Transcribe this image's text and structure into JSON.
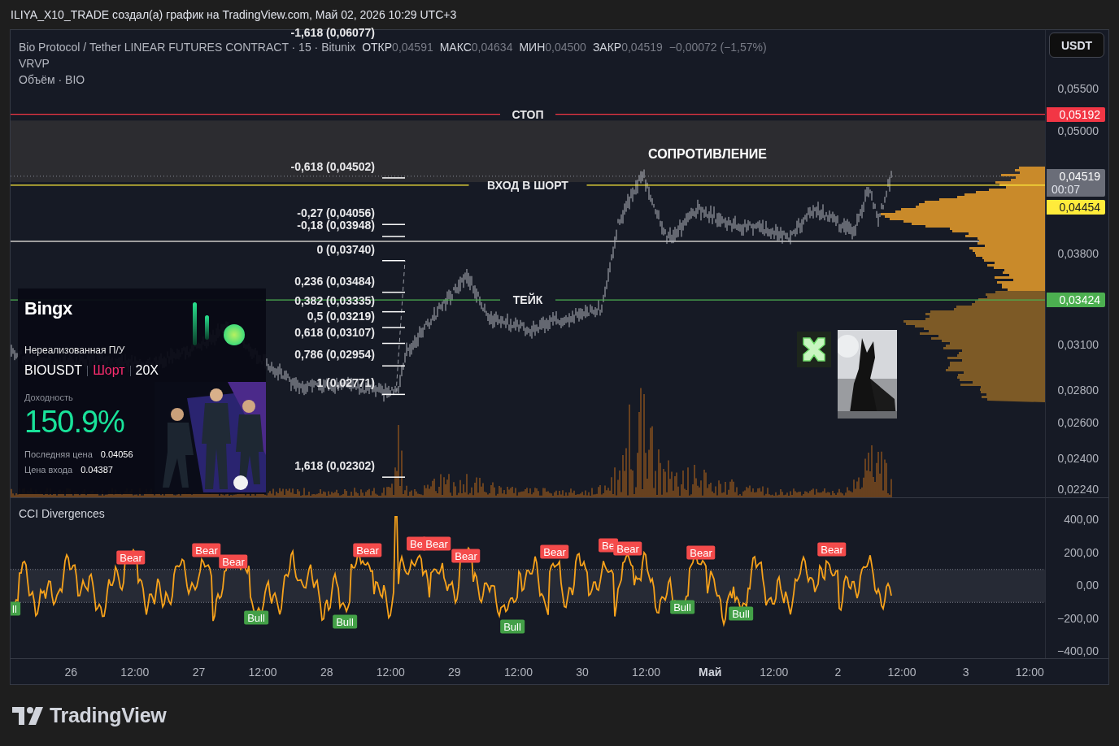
{
  "caption": "ILIYA_X10_TRADE создал(а) график на TradingView.com, Май 02, 2026 10:29 UTC+3",
  "legend": {
    "title": "Bio Protocol / Tether LINEAR FUTURES CONTRACT · 15 · Bitunix",
    "ohlc": [
      {
        "label": "ОТКР",
        "value": "0,04591"
      },
      {
        "label": "МАКС",
        "value": "0,04634"
      },
      {
        "label": "МИН",
        "value": "0,04500"
      },
      {
        "label": "ЗАКР",
        "value": "0,04519"
      }
    ],
    "change": "−0,00072 (−1,57%)"
  },
  "indicators": [
    "VRVP",
    "Объём · BIO"
  ],
  "currency_button": "USDT",
  "price_axis_ticks": [
    "0,05500",
    "0,05000",
    "0,03800",
    "0,03100",
    "0,02800",
    "0,02600",
    "0,02400",
    "0,02240"
  ],
  "last_price": {
    "value": "0,04519",
    "countdown": "00:07"
  },
  "lines": [
    {
      "label": "СТОП",
      "value": "0,05192",
      "color": "#f23645"
    },
    {
      "label": "ВХОД В ШОРТ",
      "value": "0,04454",
      "color": "#ffeb3b"
    },
    {
      "label": "ТЕЙК",
      "value": "0,03424",
      "color": "#4caf50"
    }
  ],
  "zone": {
    "label": "СОПРОТИВЛЕНИЕ"
  },
  "fib_levels": [
    "-1,618 (0,06077)",
    "-0,618 (0,04502)",
    "-0,27 (0,04056)",
    "-0,18 (0,03948)",
    "0 (0,03740)",
    "0,236 (0,03484)",
    "0,382 (0,03335)",
    "0,5 (0,03219)",
    "0,618 (0,03107)",
    "0,786 (0,02954)",
    "1 (0,02771)",
    "1,618 (0,02302)"
  ],
  "promo_card": {
    "brand": "Bingx",
    "pnl_label": "Нереализованная П/У",
    "pair": "BIOUSDT",
    "side": "Шорт",
    "leverage": "20X",
    "return_label": "Доходность",
    "return_value": "150.9%",
    "rows": [
      {
        "label": "Последняя цена",
        "value": "0.04056"
      },
      {
        "label": "Цена входа",
        "value": "0.04387"
      }
    ]
  },
  "cci": {
    "title": "CCI Divergences",
    "axis_ticks": [
      "400,00",
      "200,00",
      "0,00",
      "−200,00",
      "−400,00"
    ],
    "signals": [
      {
        "kind": "bull",
        "label": "ll"
      },
      {
        "kind": "bear",
        "label": "Bear"
      },
      {
        "kind": "bear",
        "label": "Bear"
      },
      {
        "kind": "bear",
        "label": "Bear"
      },
      {
        "kind": "bull",
        "label": "Bull"
      },
      {
        "kind": "bull",
        "label": "Bull"
      },
      {
        "kind": "bear",
        "label": "Bear"
      },
      {
        "kind": "bear",
        "label": "Be"
      },
      {
        "kind": "bear",
        "label": "Bear"
      },
      {
        "kind": "bear",
        "label": "Bear"
      },
      {
        "kind": "bull",
        "label": "Bull"
      },
      {
        "kind": "bear",
        "label": "Bear"
      },
      {
        "kind": "bear",
        "label": "Be"
      },
      {
        "kind": "bear",
        "label": "Bear"
      },
      {
        "kind": "bull",
        "label": "Bull"
      },
      {
        "kind": "bear",
        "label": "Bear"
      },
      {
        "kind": "bull",
        "label": "Bull"
      },
      {
        "kind": "bear",
        "label": "Bear"
      }
    ]
  },
  "time_axis": [
    {
      "label": "26",
      "bold": false
    },
    {
      "label": "12:00",
      "bold": false
    },
    {
      "label": "27",
      "bold": false
    },
    {
      "label": "12:00",
      "bold": false
    },
    {
      "label": "28",
      "bold": false
    },
    {
      "label": "12:00",
      "bold": false
    },
    {
      "label": "29",
      "bold": false
    },
    {
      "label": "12:00",
      "bold": false
    },
    {
      "label": "30",
      "bold": false
    },
    {
      "label": "12:00",
      "bold": false
    },
    {
      "label": "Май",
      "bold": true
    },
    {
      "label": "12:00",
      "bold": false
    },
    {
      "label": "2",
      "bold": false
    },
    {
      "label": "12:00",
      "bold": false
    },
    {
      "label": "3",
      "bold": false
    },
    {
      "label": "12:00",
      "bold": false
    }
  ],
  "footer": {
    "logo_text": "TradingView"
  }
}
